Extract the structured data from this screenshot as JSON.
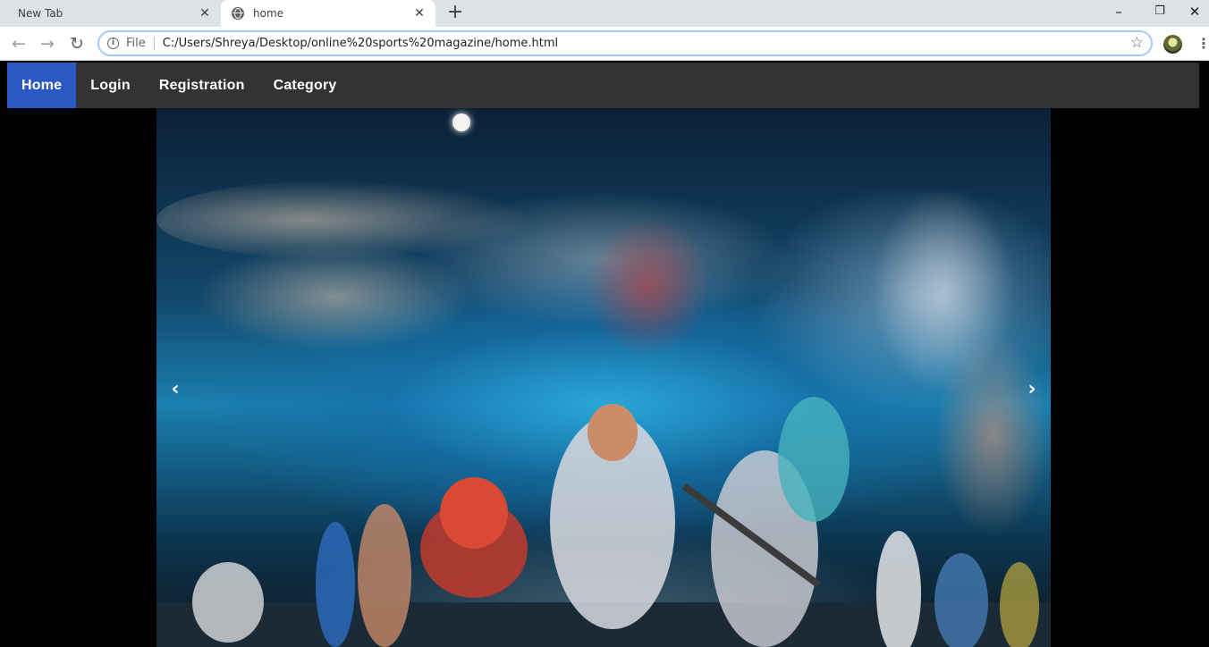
{
  "browser": {
    "tabs": [
      {
        "title": "New Tab",
        "active": false
      },
      {
        "title": "home",
        "active": true
      }
    ],
    "new_tab_icon": "plus-icon",
    "window_controls": {
      "minimize": "–",
      "restore": "❐",
      "close": "✕"
    },
    "address_bar": {
      "scheme_label": "File",
      "url": "C:/Users/Shreya/Desktop/online%20sports%20magazine/home.html"
    }
  },
  "site": {
    "nav": [
      {
        "label": "Home",
        "active": true
      },
      {
        "label": "Login",
        "active": false
      },
      {
        "label": "Registration",
        "active": false
      },
      {
        "label": "Category",
        "active": false
      }
    ],
    "slideshow": {
      "prev_label": "‹",
      "next_label": "›"
    }
  },
  "colors": {
    "nav_background": "#333333",
    "nav_active": "#2b59c3",
    "page_background": "#000000"
  }
}
